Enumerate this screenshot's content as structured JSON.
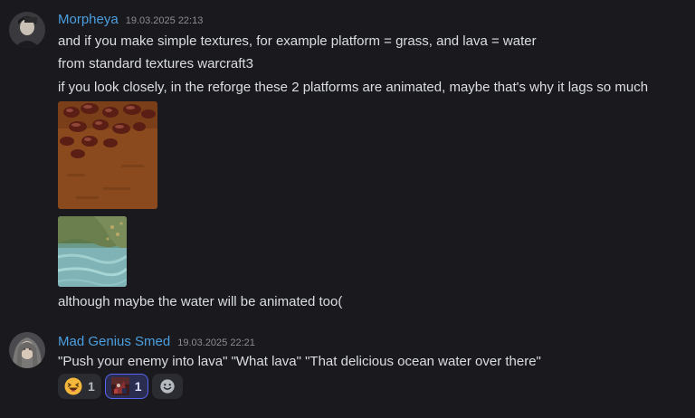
{
  "messages": [
    {
      "username": "Morpheya",
      "timestamp": "19.03.2025 22:13",
      "avatar_icon": "user-avatar",
      "lines": [
        "and if you make simple textures, for example platform = grass, and lava = water",
        "from standard textures warcraft3",
        "if you look closely, in the reforge these 2 platforms are animated, maybe that's why it lags so much"
      ],
      "attachments": [
        "lava-texture-image",
        "water-texture-image"
      ],
      "after_text": "although maybe the water will be animated too("
    },
    {
      "username": "Mad Genius Smed",
      "timestamp": "19.03.2025 22:21",
      "avatar_icon": "user-avatar",
      "lines": [
        "\"Push your enemy into lava\" \"What lava\" \"That delicious ocean water over there\""
      ],
      "reactions": [
        {
          "emoji": "laughing-face-icon",
          "count": "1",
          "active": false
        },
        {
          "emoji": "custom-emoji-icon",
          "count": "1",
          "active": true
        }
      ],
      "add_reaction_icon": "add-reaction-smiley-icon"
    }
  ],
  "colors": {
    "background": "#1a1a1e",
    "username": "#4b9fe0",
    "text": "#dbdee1",
    "timestamp": "#8a8d93",
    "reaction_active_border": "#5865f2"
  }
}
